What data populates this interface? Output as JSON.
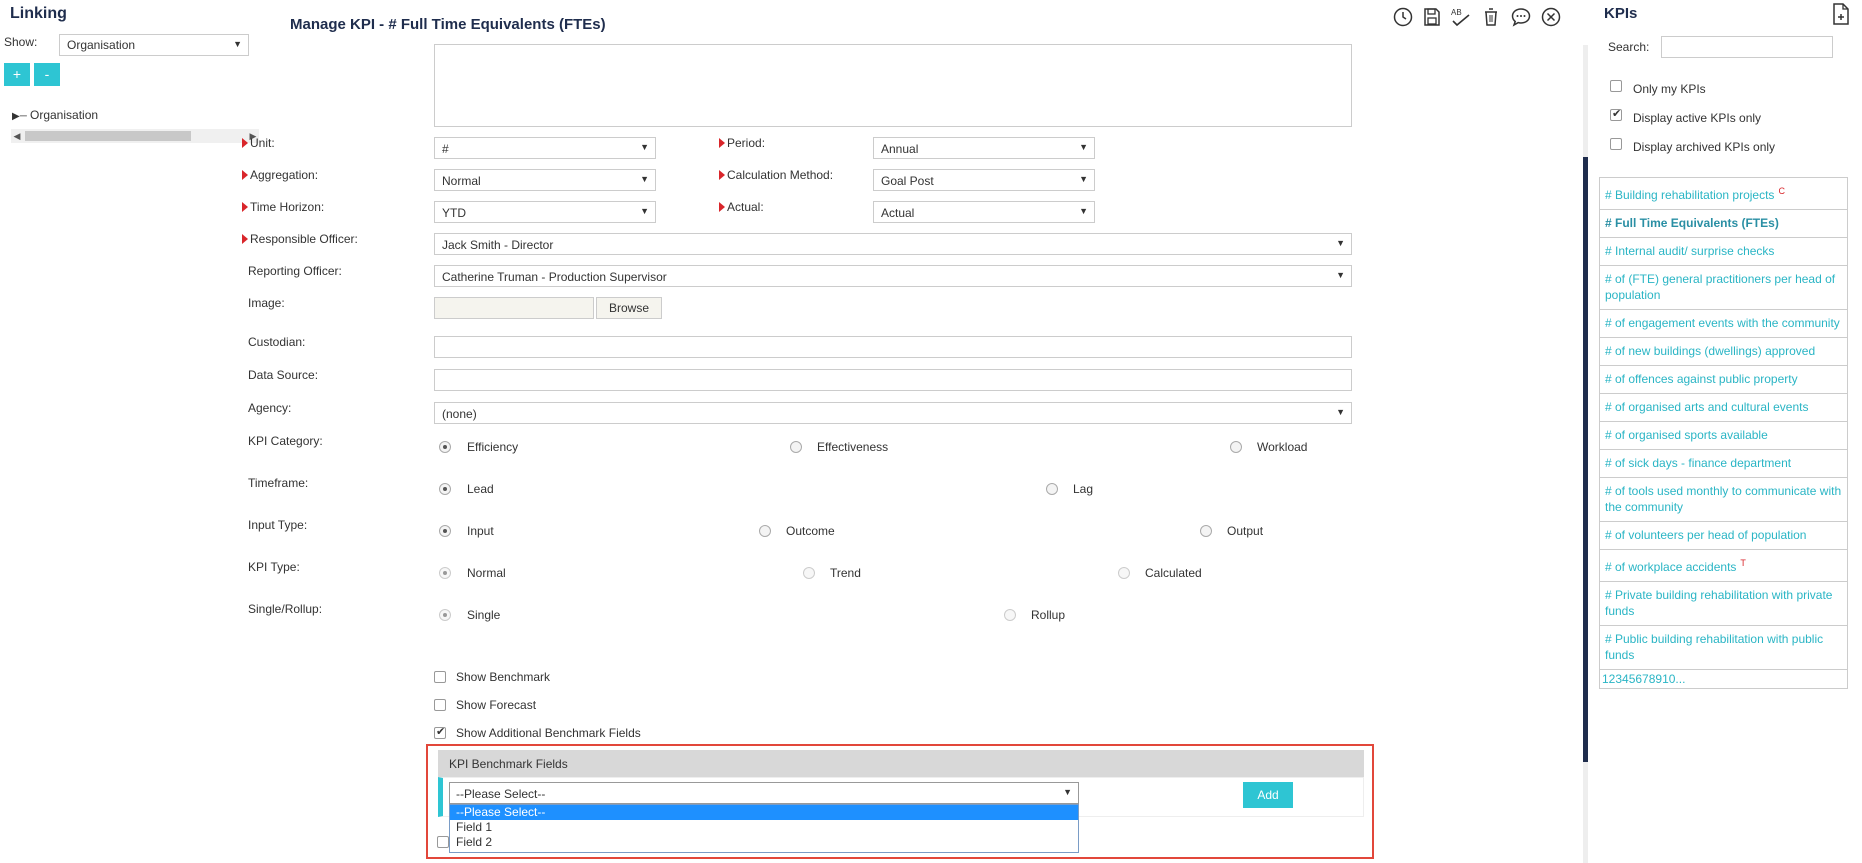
{
  "left": {
    "title": "Linking",
    "show_label": "Show:",
    "show_value": "Organisation",
    "plus_label": "+",
    "minus_label": "-",
    "tree_item": "Organisation"
  },
  "header": {
    "title": "Manage KPI - # Full Time Equivalents (FTEs)",
    "spell_label": "AB"
  },
  "form": {
    "unit_label": "Unit:",
    "unit_value": "#",
    "period_label": "Period:",
    "period_value": "Annual",
    "aggregation_label": "Aggregation:",
    "aggregation_value": "Normal",
    "calc_label": "Calculation Method:",
    "calc_value": "Goal Post",
    "horizon_label": "Time Horizon:",
    "horizon_value": "YTD",
    "actual_label": "Actual:",
    "actual_value": "Actual",
    "resp_label": "Responsible Officer:",
    "resp_value": "Jack Smith - Director",
    "reporting_label": "Reporting Officer:",
    "reporting_value": "Catherine Truman - Production Supervisor",
    "image_label": "Image:",
    "browse_label": "Browse",
    "custodian_label": "Custodian:",
    "datasource_label": "Data Source:",
    "agency_label": "Agency:",
    "agency_value": "(none)",
    "category_label": "KPI Category:",
    "category_options": [
      "Efficiency",
      "Effectiveness",
      "Workload"
    ],
    "category_selected": "Efficiency",
    "timeframe_label": "Timeframe:",
    "timeframe_options": [
      "Lead",
      "Lag"
    ],
    "timeframe_selected": "Lead",
    "inputtype_label": "Input Type:",
    "inputtype_options": [
      "Input",
      "Outcome",
      "Output"
    ],
    "inputtype_selected": "Input",
    "kpitype_label": "KPI Type:",
    "kpitype_options": [
      "Normal",
      "Trend",
      "Calculated"
    ],
    "kpitype_selected": "Normal",
    "rollup_label": "Single/Rollup:",
    "rollup_options": [
      "Single",
      "Rollup"
    ],
    "rollup_selected": "Single",
    "show_benchmark": "Show Benchmark",
    "show_benchmark_checked": false,
    "show_forecast": "Show Forecast",
    "show_forecast_checked": false,
    "show_additional": "Show Additional Benchmark Fields",
    "show_additional_checked": true
  },
  "benchmark": {
    "header": "KPI Benchmark Fields",
    "select_value": "--Please Select--",
    "add_label": "Add",
    "options": [
      "--Please Select--",
      "Field 1",
      "Field 2"
    ],
    "highlight_color": "#e2473a"
  },
  "right": {
    "title": "KPIs",
    "search_label": "Search:",
    "filter_my": "Only my KPIs",
    "filter_my_checked": false,
    "filter_active": "Display active KPIs only",
    "filter_active_checked": true,
    "filter_archived": "Display archived KPIs only",
    "filter_archived_checked": false,
    "kpis": [
      {
        "label": "# Building rehabilitation projects",
        "tag": "C"
      },
      {
        "label": "# Full Time Equivalents (FTEs)",
        "tag": ""
      },
      {
        "label": "# Internal audit/ surprise checks",
        "tag": ""
      },
      {
        "label": "# of (FTE) general practitioners per head of population",
        "tag": ""
      },
      {
        "label": "# of engagement events with the community",
        "tag": ""
      },
      {
        "label": "# of new buildings (dwellings) approved",
        "tag": ""
      },
      {
        "label": "# of offences against public property",
        "tag": ""
      },
      {
        "label": "# of organised arts and cultural events",
        "tag": ""
      },
      {
        "label": "# of organised sports available",
        "tag": ""
      },
      {
        "label": "# of sick days - finance department",
        "tag": ""
      },
      {
        "label": "# of tools used monthly to communicate with the community",
        "tag": ""
      },
      {
        "label": "# of volunteers per head of population",
        "tag": ""
      },
      {
        "label": "# of workplace accidents",
        "tag": "T"
      },
      {
        "label": "# Private building rehabilitation with private funds",
        "tag": ""
      },
      {
        "label": "# Public building rehabilitation with public funds",
        "tag": ""
      }
    ],
    "pager": "12345678910..."
  },
  "colors": {
    "accent": "#2ec5d3",
    "title": "#1f2d4d",
    "link": "#2ab5c5",
    "required": "#d9262b"
  }
}
